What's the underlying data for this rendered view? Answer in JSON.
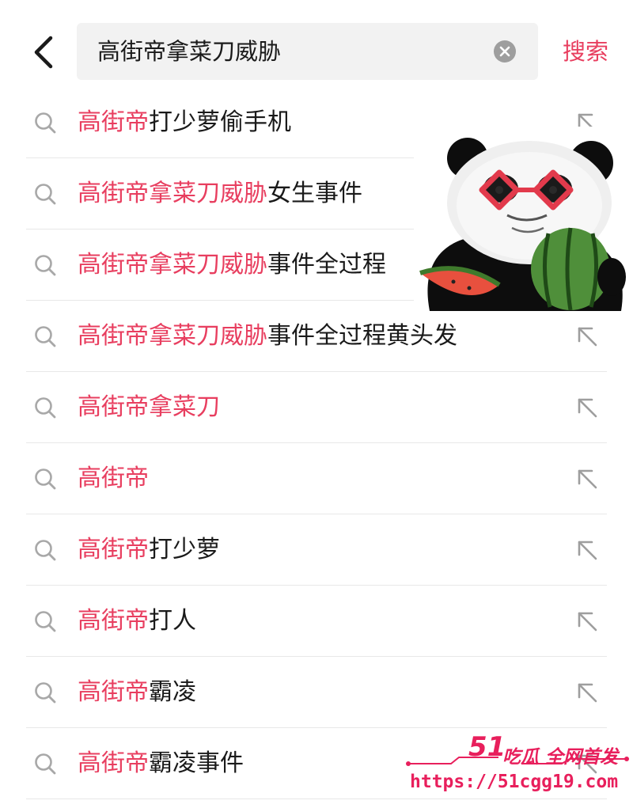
{
  "search": {
    "query": "高街帝拿菜刀威胁",
    "submit_label": "搜索"
  },
  "suggestions": [
    {
      "highlight": "高街帝",
      "rest": "打少萝偷手机"
    },
    {
      "highlight": "高街帝拿菜刀威胁",
      "rest": "女生事件"
    },
    {
      "highlight": "高街帝拿菜刀威胁",
      "rest": "事件全过程"
    },
    {
      "highlight": "高街帝拿菜刀威胁",
      "rest": "事件全过程黄头发"
    },
    {
      "highlight": "高街帝拿菜刀",
      "rest": ""
    },
    {
      "highlight": "高街帝",
      "rest": ""
    },
    {
      "highlight": "高街帝",
      "rest": "打少萝"
    },
    {
      "highlight": "高街帝",
      "rest": "打人"
    },
    {
      "highlight": "高街帝",
      "rest": "霸凌"
    },
    {
      "highlight": "高街帝",
      "rest": "霸凌事件"
    }
  ],
  "watermark": {
    "brand": "吃瓜 全网首发",
    "brand_number": "51",
    "url": "https://51cgg19.com"
  },
  "icons": {
    "back": "chevron-left-icon",
    "clear": "clear-circle-icon",
    "row_search": "search-icon",
    "row_fill": "arrow-up-left-icon"
  },
  "colors": {
    "accent": "#e83e5f",
    "search_bg": "#f2f2f2",
    "divider": "#e8e8e8",
    "watermark": "#e81f5c"
  }
}
